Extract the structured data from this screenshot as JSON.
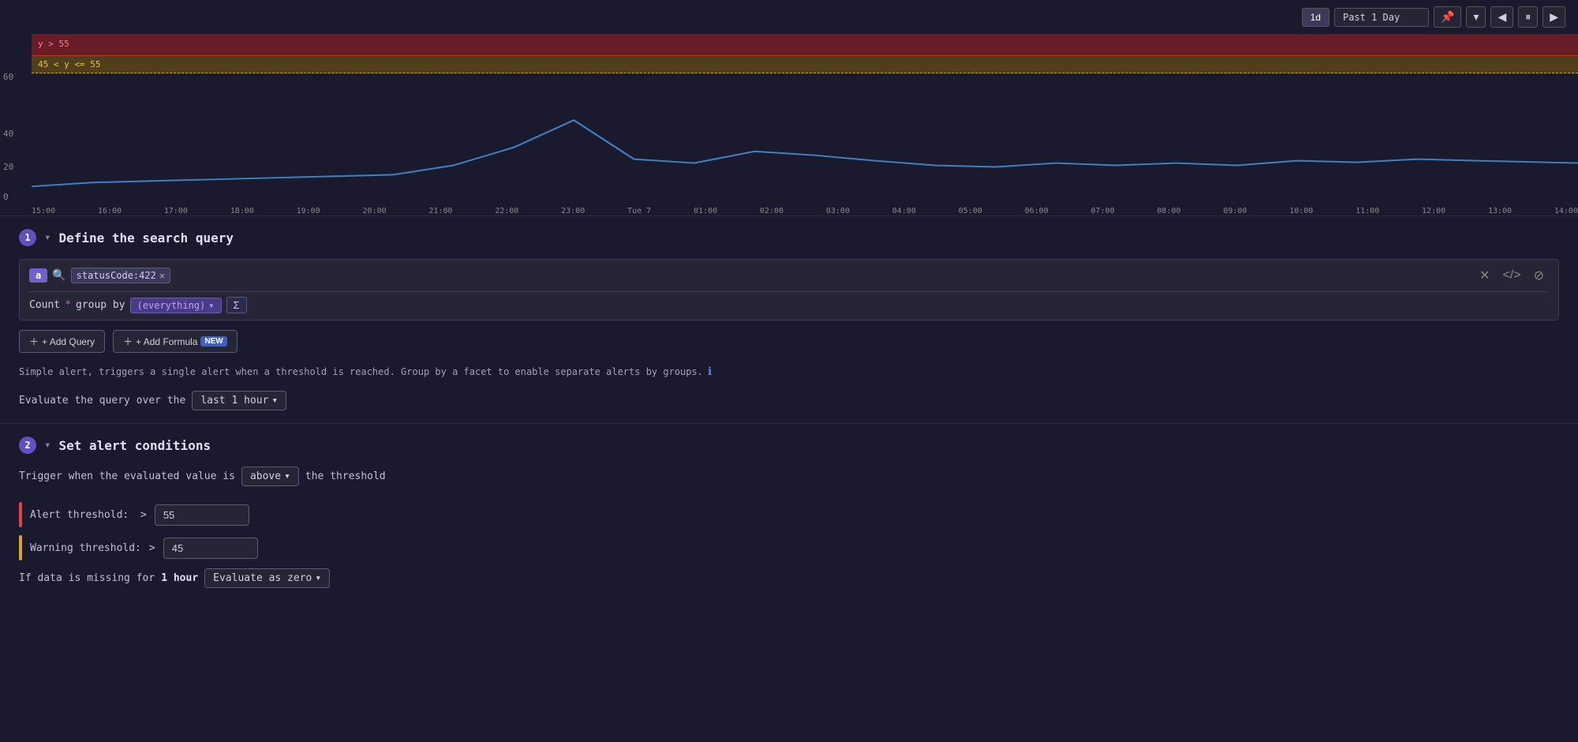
{
  "toolbar": {
    "timeBtn": "1d",
    "timeRange": "Past 1 Day"
  },
  "chart": {
    "bands": [
      {
        "label": "y > 55",
        "type": "red"
      },
      {
        "label": "45 < y <= 55",
        "type": "yellow"
      }
    ],
    "yLabels": [
      {
        "value": "60",
        "pct": 0
      },
      {
        "value": "40",
        "pct": 40
      },
      {
        "value": "20",
        "pct": 70
      },
      {
        "value": "0",
        "pct": 97
      }
    ],
    "xLabels": [
      "15:00",
      "16:00",
      "17:00",
      "18:00",
      "19:00",
      "20:00",
      "21:00",
      "22:00",
      "23:00",
      "Tue 7",
      "01:00",
      "02:00",
      "03:00",
      "04:00",
      "05:00",
      "06:00",
      "07:00",
      "08:00",
      "09:00",
      "10:00",
      "11:00",
      "12:00",
      "13:00",
      "14:00"
    ]
  },
  "section1": {
    "step": "1",
    "title": "Define the search query",
    "queryLabel": "a",
    "searchTag": "statusCode:422",
    "countLabel": "Count",
    "star": "*",
    "groupByLabel": "group by",
    "everythingLabel": "(everything)",
    "sumSymbol": "Σ",
    "addQueryLabel": "+ Add Query",
    "addFormulaLabel": "+ Add Formula",
    "addFormulaNew": "NEW",
    "infoText": "Simple alert, triggers a single alert when a threshold is reached. Group by a facet to enable separate alerts by groups.",
    "evaluateLabel": "Evaluate the query over the",
    "evaluateOption": "last 1 hour"
  },
  "section2": {
    "step": "2",
    "title": "Set alert conditions",
    "triggerLabel": "Trigger when the evaluated value is",
    "triggerOption": "above",
    "triggerSuffix": "the threshold",
    "alertThresholdLabel": "Alert threshold:",
    "alertOp": ">",
    "alertValue": "55",
    "warningThresholdLabel": "Warning threshold:",
    "warningOp": ">",
    "warningValue": "45",
    "missingPrefix": "If data is missing for",
    "missingDuration": "1 hour",
    "missingOption": "Evaluate as zero"
  }
}
